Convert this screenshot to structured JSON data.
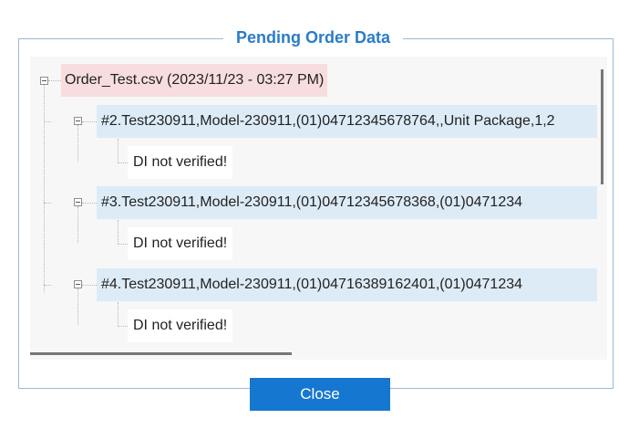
{
  "window": {
    "title": "Pending Order Data"
  },
  "tree": {
    "root": {
      "label": "Order_Test.csv (2023/11/23 - 03:27 PM)"
    },
    "rows": [
      {
        "label": "#2.Test230911,Model-230911,(01)04712345678764,,Unit Package,1,2",
        "child": "DI not verified!"
      },
      {
        "label": "#3.Test230911,Model-230911,(01)04712345678368,(01)0471234",
        "child": "DI not verified!"
      },
      {
        "label": "#4.Test230911,Model-230911,(01)04716389162401,(01)0471234",
        "child": "DI not verified!"
      }
    ]
  },
  "buttons": {
    "close": "Close"
  },
  "colors": {
    "accent": "#2a7cc7",
    "button": "#1677d0",
    "root_highlight": "#f7dddd",
    "row_highlight": "#ddebf6"
  }
}
